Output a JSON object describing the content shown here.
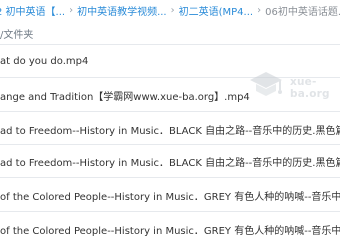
{
  "breadcrumb": {
    "items": [
      {
        "label": "2 初中英语【..."
      },
      {
        "label": "初中英语教学视频..."
      },
      {
        "label": "初二英语(MP4..."
      },
      {
        "label": "06初中英语话题..."
      }
    ]
  },
  "section_label": "/文件夹",
  "files": [
    {
      "name": "at do you do.mp4"
    },
    {
      "name": "ange and Tradition【学霸网www.xue-ba.org】.mp4"
    },
    {
      "name": "ad to Freedom--History in Music．BLACK 自由之路--音乐中的历史.黑色篇.doc"
    },
    {
      "name": "ad to Freedom--History in Music．BLACK 自由之路--音乐中的历史.黑色篇.mp4"
    },
    {
      "name": "of the Colored People--History in Music．GREY 有色人种的呐喊--音乐中的历史.灰色"
    },
    {
      "name": "of the Colored People--History in Music．GREY 有色人种的呐喊--音乐中的历史.灰色"
    }
  ],
  "watermark": {
    "text": "xue-ba.org"
  },
  "colors": {
    "link": "#2a8bd8",
    "text": "#333333",
    "divider": "#e6e9ed",
    "background": "#ffffff"
  }
}
